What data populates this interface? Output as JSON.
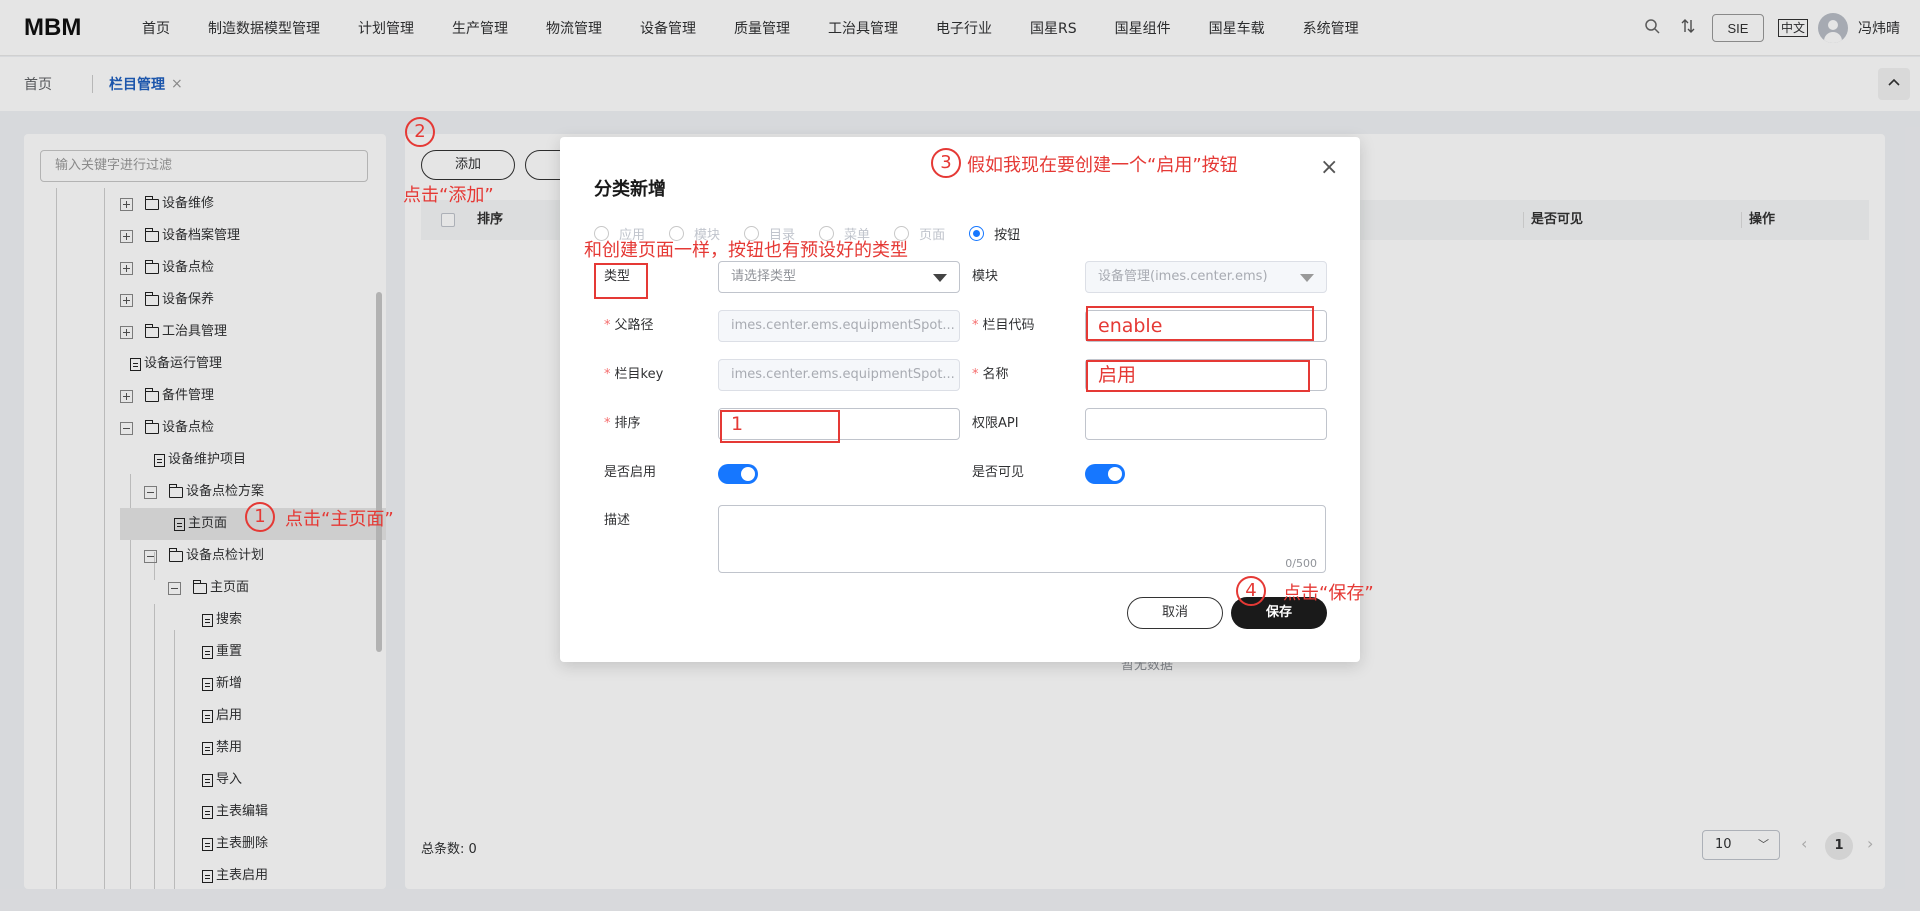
{
  "app": {
    "logo": "MBM",
    "menu": [
      "首页",
      "制造数据模型管理",
      "计划管理",
      "生产管理",
      "物流管理",
      "设备管理",
      "质量管理",
      "工治具管理",
      "电子行业",
      "国星RS",
      "国星组件",
      "国星车载",
      "系统管理"
    ],
    "sie": "SIE",
    "lang": "中文",
    "user": "冯炜晴"
  },
  "tabs": {
    "home": "首页",
    "active": "栏目管理",
    "close": "×"
  },
  "tree": {
    "filter_placeholder": "输入关键字进行过滤",
    "nodes": [
      {
        "label": "设备维修",
        "icon": "folder",
        "toggle": "plus"
      },
      {
        "label": "设备档案管理",
        "icon": "folder",
        "toggle": "plus"
      },
      {
        "label": "设备点检",
        "icon": "folder",
        "toggle": "plus"
      },
      {
        "label": "设备保养",
        "icon": "folder",
        "toggle": "plus"
      },
      {
        "label": "工治具管理",
        "icon": "folder",
        "toggle": "plus"
      },
      {
        "label": "设备运行管理",
        "icon": "file",
        "toggle": "none"
      },
      {
        "label": "备件管理",
        "icon": "folder",
        "toggle": "plus"
      },
      {
        "label": "设备点检",
        "icon": "folder",
        "toggle": "minus"
      },
      {
        "label": "设备维护项目",
        "icon": "file",
        "toggle": "none"
      },
      {
        "label": "设备点检方案",
        "icon": "folder",
        "toggle": "minus"
      },
      {
        "label": "主页面",
        "icon": "file",
        "toggle": "none",
        "selected": true
      },
      {
        "label": "设备点检计划",
        "icon": "folder",
        "toggle": "minus"
      },
      {
        "label": "主页面",
        "icon": "folder",
        "toggle": "minus"
      },
      {
        "label": "搜索",
        "icon": "file",
        "toggle": "none"
      },
      {
        "label": "重置",
        "icon": "file",
        "toggle": "none"
      },
      {
        "label": "新增",
        "icon": "file",
        "toggle": "none"
      },
      {
        "label": "启用",
        "icon": "file",
        "toggle": "none"
      },
      {
        "label": "禁用",
        "icon": "file",
        "toggle": "none"
      },
      {
        "label": "导入",
        "icon": "file",
        "toggle": "none"
      },
      {
        "label": "主表编辑",
        "icon": "file",
        "toggle": "none"
      },
      {
        "label": "主表删除",
        "icon": "file",
        "toggle": "none"
      },
      {
        "label": "主表启用",
        "icon": "file",
        "toggle": "none"
      }
    ]
  },
  "main": {
    "add_button": "添加",
    "columns": {
      "sort": "排序",
      "visible": "是否可见",
      "ops": "操作"
    },
    "no_data": "暂无数据",
    "total": "总条数: 0",
    "page_size": "10",
    "page_current": "1"
  },
  "dialog": {
    "title": "分类新增",
    "close": "×",
    "radios": [
      "应用",
      "模块",
      "目录",
      "菜单",
      "页面",
      "按钮"
    ],
    "radio_selected": "按钮",
    "type_label": "类型",
    "type_placeholder": "请选择类型",
    "module_label": "模块",
    "module_value": "设备管理(imes.center.ems)",
    "parent_path_label": "父路径",
    "parent_path_value": "imes.center.ems.equipmentSpot...",
    "code_label": "栏目代码",
    "code_value": "enable",
    "key_label": "栏目key",
    "key_value": "imes.center.ems.equipmentSpot...",
    "name_label": "名称",
    "name_value": "启用",
    "sort_label": "排序",
    "sort_value": "1",
    "api_label": "权限API",
    "api_value": "",
    "enabled_label": "是否启用",
    "visible_label": "是否可见",
    "enabled": true,
    "visible": true,
    "desc_label": "描述",
    "desc_counter": "0/500",
    "cancel": "取消",
    "save": "保存"
  },
  "annotations": {
    "n1": "1",
    "t1": "点击“主页面”",
    "n2": "2",
    "t2": "点击“添加”",
    "n3": "3",
    "t3": "假如我现在要创建一个“启用”按钮",
    "n4": "4",
    "t4": "点击“保存”",
    "t5": "和创建页面一样，按钮也有预设好的类型"
  },
  "colors": {
    "accent": "#1677ff",
    "annotation": "#e53935",
    "active_tab": "#1f5fbf"
  }
}
